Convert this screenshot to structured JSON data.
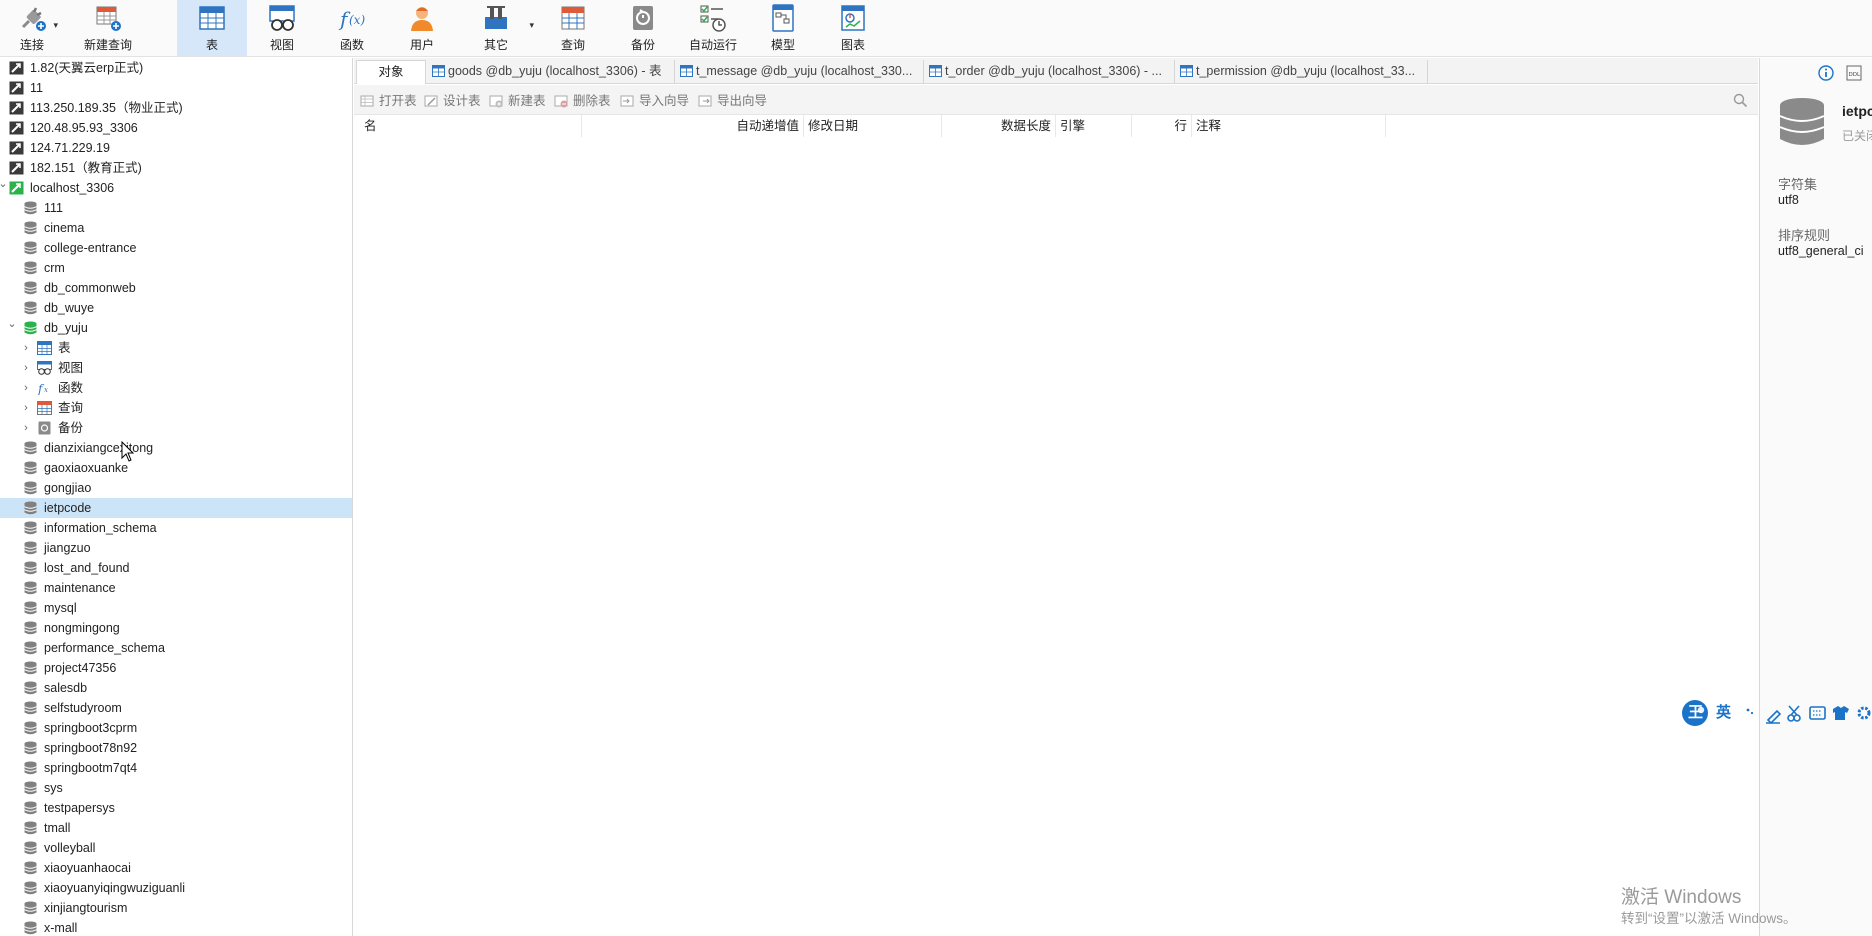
{
  "toolbar": {
    "buttons": [
      {
        "label": "连接",
        "icon": "plug-icon"
      },
      {
        "label": "新建查询",
        "icon": "new-query-icon"
      },
      {
        "label": "表",
        "icon": "table-icon",
        "active": true
      },
      {
        "label": "视图",
        "icon": "view-icon"
      },
      {
        "label": "函数",
        "icon": "function-icon"
      },
      {
        "label": "用户",
        "icon": "user-icon"
      },
      {
        "label": "其它",
        "icon": "tools-icon"
      },
      {
        "label": "查询",
        "icon": "query-icon"
      },
      {
        "label": "备份",
        "icon": "backup-icon"
      },
      {
        "label": "自动运行",
        "icon": "auto-run-icon"
      },
      {
        "label": "模型",
        "icon": "model-icon"
      },
      {
        "label": "图表",
        "icon": "chart-icon"
      }
    ]
  },
  "sidebar": {
    "connections": [
      {
        "label": "1.82(天翼云erp正式)"
      },
      {
        "label": "11"
      },
      {
        "label": "113.250.189.35（物业正式)"
      },
      {
        "label": "120.48.95.93_3306"
      },
      {
        "label": "124.71.229.19"
      },
      {
        "label": "182.151（教育正式)"
      },
      {
        "label": "localhost_3306"
      }
    ],
    "databases_before": [
      "111",
      "cinema",
      "college-entrance",
      "crm",
      "db_commonweb",
      "db_wuye",
      "db_yuju"
    ],
    "db_yuju_children": [
      "表",
      "视图",
      "函数",
      "查询",
      "备份"
    ],
    "databases_after": [
      "dianzixiangcexitong",
      "gaoxiaoxuanke",
      "gongjiao",
      "ietpcode",
      "information_schema",
      "jiangzuo",
      "lost_and_found",
      "maintenance",
      "mysql",
      "nongmingong",
      "performance_schema",
      "project47356",
      "salesdb",
      "selfstudyroom",
      "springboot3cprm",
      "springboot78n92",
      "springbootm7qt4",
      "sys",
      "testpapersys",
      "tmall",
      "volleyball",
      "xiaoyuanhaocai",
      "xiaoyuanyiqingwuziguanli",
      "xinjiangtourism",
      "x-mall"
    ],
    "selected": "ietpcode"
  },
  "tabs": {
    "object_label": "对象",
    "items": [
      "goods @db_yuju (localhost_3306) - 表",
      "t_message @db_yuju (localhost_330...",
      "t_order @db_yuju (localhost_3306) - ...",
      "t_permission @db_yuju (localhost_33..."
    ]
  },
  "actions": [
    "打开表",
    "设计表",
    "新建表",
    "删除表",
    "导入向导",
    "导出向导"
  ],
  "columns": [
    "名",
    "自动递增值",
    "修改日期",
    "数据长度",
    "引擎",
    "行",
    "注释"
  ],
  "info_panel": {
    "title": "ietpc",
    "status": "已关闭",
    "charset_label": "字符集",
    "charset_value": "utf8",
    "collation_label": "排序规则",
    "collation_value": "utf8_general_ci"
  },
  "ime": {
    "logo": "王",
    "mode": "英"
  },
  "watermark": {
    "line1": "激活 Windows",
    "line2": "转到“设置”以激活 Windows。"
  },
  "colors": {
    "accent": "#1a73c8",
    "selected_row": "#cce4f7",
    "active_tool": "#d5e7f8",
    "db_icon": "#808080",
    "db_open": "#2bb24c"
  }
}
